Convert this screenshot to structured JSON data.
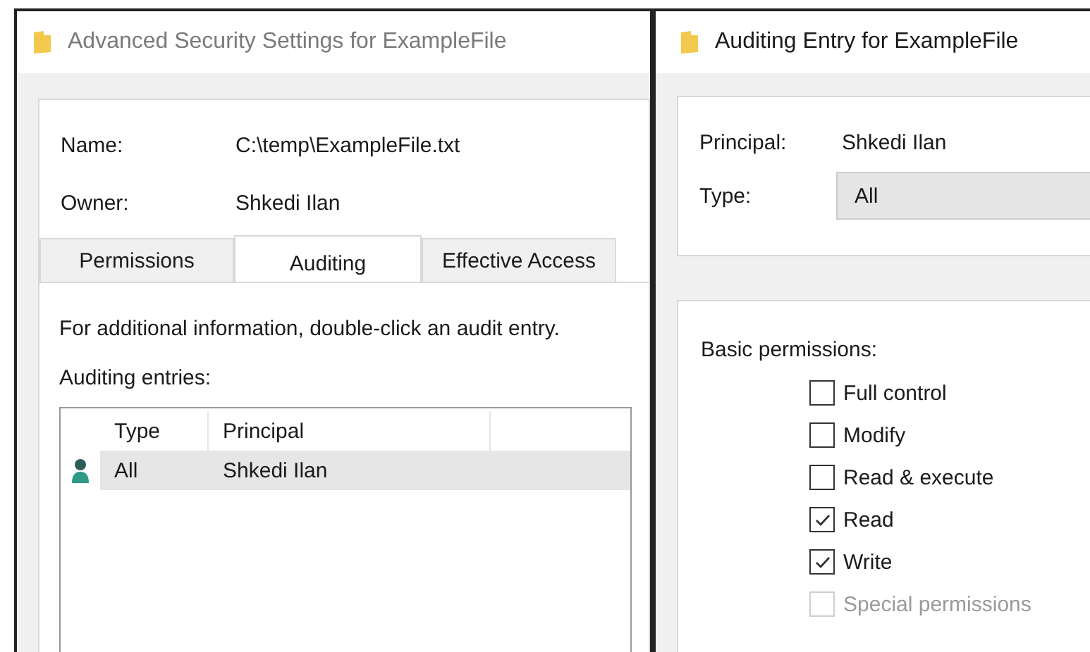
{
  "left_window": {
    "title": "Advanced Security Settings for ExampleFile",
    "fields": [
      {
        "label": "Name:",
        "value": "C:\\temp\\ExampleFile.txt"
      },
      {
        "label": "Owner:",
        "value": "Shkedi Ilan"
      }
    ],
    "tabs": [
      {
        "label": "Permissions",
        "selected": false
      },
      {
        "label": "Auditing",
        "selected": true
      },
      {
        "label": "Effective Access",
        "selected": false
      }
    ],
    "info": "For additional information, double-click an audit entry.",
    "entries_label": "Auditing entries:",
    "table": {
      "columns": [
        "Type",
        "Principal"
      ],
      "rows": [
        {
          "type": "All",
          "principal": "Shkedi Ilan",
          "selected": true
        }
      ]
    }
  },
  "right_window": {
    "title": "Auditing Entry for ExampleFile",
    "principal": {
      "label": "Principal:",
      "value": "Shkedi Ilan"
    },
    "type": {
      "label": "Type:",
      "value": "All"
    },
    "permissions_label": "Basic permissions:",
    "permissions": [
      {
        "label": "Full control",
        "checked": false,
        "disabled": false
      },
      {
        "label": "Modify",
        "checked": false,
        "disabled": false
      },
      {
        "label": "Read & execute",
        "checked": false,
        "disabled": false
      },
      {
        "label": "Read",
        "checked": true,
        "disabled": false
      },
      {
        "label": "Write",
        "checked": true,
        "disabled": false
      },
      {
        "label": "Special permissions",
        "checked": false,
        "disabled": true
      }
    ]
  }
}
